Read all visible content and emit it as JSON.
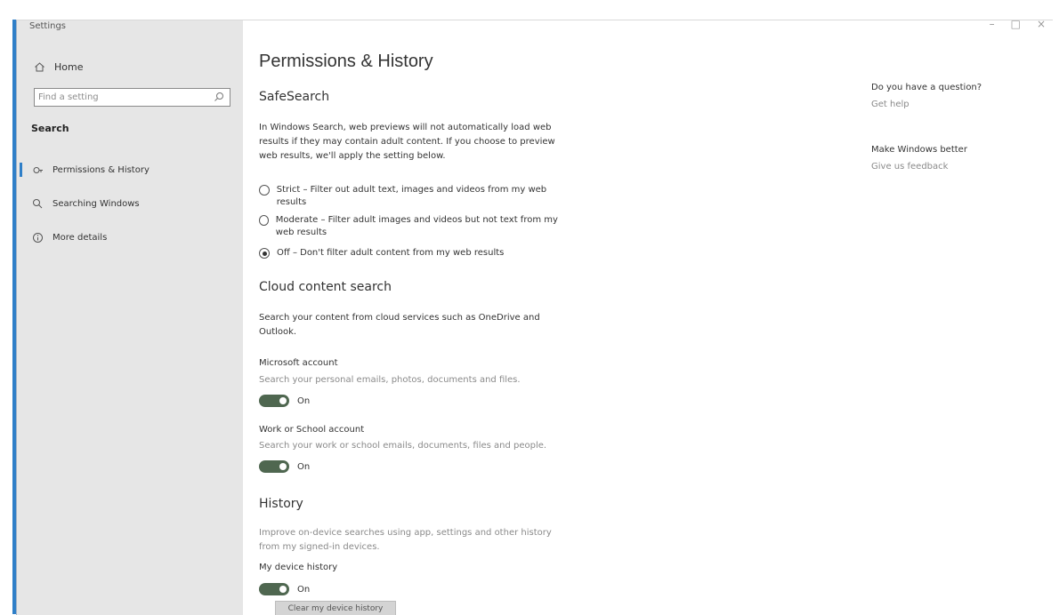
{
  "window": {
    "title": "Settings",
    "controls": {
      "minimize": "–",
      "maximize": "□",
      "close": "×"
    }
  },
  "sidebar": {
    "home_label": "Home",
    "search_placeholder": "Find a setting",
    "section_label": "Search",
    "items": [
      {
        "label": "Permissions & History",
        "icon": "permissions-icon",
        "active": true
      },
      {
        "label": "Searching Windows",
        "icon": "search-icon",
        "active": false
      },
      {
        "label": "More details",
        "icon": "info-icon",
        "active": false
      }
    ]
  },
  "main": {
    "page_title": "Permissions & History",
    "safesearch": {
      "title": "SafeSearch",
      "description": "In Windows Search, web previews will not automatically load web results if they may contain adult content. If you choose to preview web results, we'll apply the setting below.",
      "options": [
        {
          "label": "Strict – Filter out adult text, images and videos from my web results",
          "checked": false
        },
        {
          "label": "Moderate – Filter adult images and videos but not text from my web results",
          "checked": false
        },
        {
          "label": "Off – Don't filter adult content from my web results",
          "checked": true
        }
      ]
    },
    "cloud": {
      "title": "Cloud content search",
      "description": "Search your content from cloud services such as OneDrive and Outlook.",
      "accounts": [
        {
          "name": "Microsoft account",
          "description": "Search your personal emails, photos, documents and files.",
          "state": "On"
        },
        {
          "name": "Work or School account",
          "description": "Search your work or school emails, documents, files and people.",
          "state": "On"
        }
      ]
    },
    "history": {
      "title": "History",
      "description": "Improve on-device searches using app, settings and other history from my signed-in devices.",
      "device_history_label": "My device history",
      "state": "On",
      "clear_button": "Clear my device history"
    }
  },
  "help": {
    "question_heading": "Do you have a question?",
    "question_link": "Get help",
    "feedback_heading": "Make Windows better",
    "feedback_link": "Give us feedback"
  },
  "colors": {
    "sidebar_bg": "#e6e6e6",
    "accent_blue": "#2f7fc8",
    "toggle_on": "#4f6750",
    "muted_text": "#8a8a8a"
  }
}
